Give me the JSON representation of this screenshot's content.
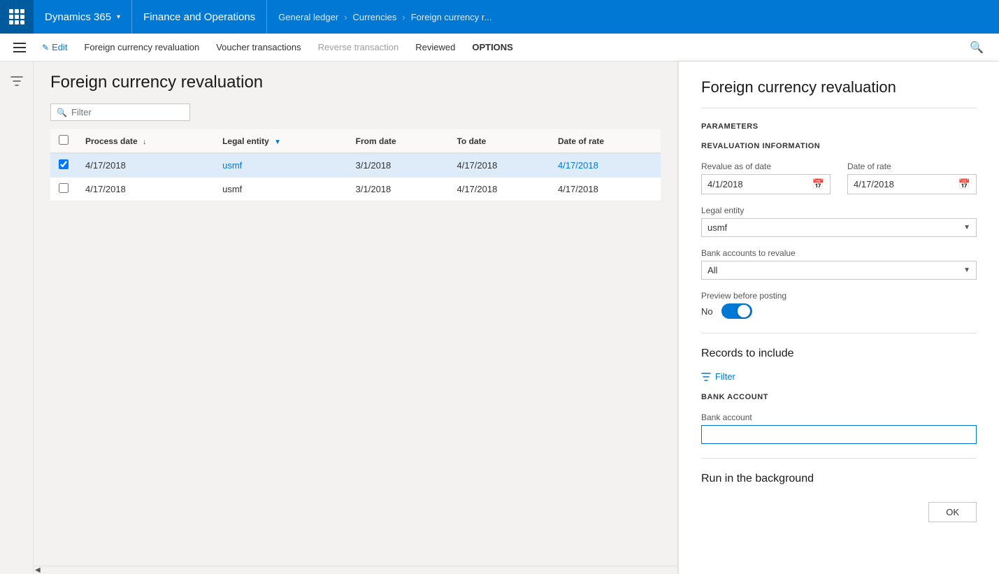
{
  "topNav": {
    "appsLabel": "Apps",
    "dynamics365": "Dynamics 365",
    "chevron": "▾",
    "financeOps": "Finance and Operations",
    "breadcrumbs": [
      {
        "label": "General ledger"
      },
      {
        "label": "Currencies"
      },
      {
        "label": "Foreign currency r..."
      }
    ]
  },
  "secondaryNav": {
    "editLabel": "Edit",
    "tabs": [
      {
        "label": "Foreign currency revaluation",
        "disabled": false
      },
      {
        "label": "Voucher transactions",
        "disabled": false
      },
      {
        "label": "Reverse transaction",
        "disabled": true
      },
      {
        "label": "Reviewed",
        "disabled": false
      },
      {
        "label": "OPTIONS",
        "disabled": false,
        "bold": true
      }
    ]
  },
  "pageTitle": "Foreign currency revaluation",
  "filter": {
    "placeholder": "Filter"
  },
  "table": {
    "columns": [
      {
        "label": "",
        "type": "checkbox"
      },
      {
        "label": "Process date",
        "sortable": true
      },
      {
        "label": "Legal entity",
        "filterable": true
      },
      {
        "label": "From date"
      },
      {
        "label": "To date"
      },
      {
        "label": "Date of rate"
      }
    ],
    "rows": [
      {
        "selected": true,
        "processDate": "4/17/2018",
        "legalEntity": "usmf",
        "legalEntityLink": true,
        "fromDate": "3/1/2018",
        "toDate": "4/17/2018",
        "dateOfRate": "4/17/2018"
      },
      {
        "selected": false,
        "processDate": "4/17/2018",
        "legalEntity": "usmf",
        "legalEntityLink": false,
        "fromDate": "3/1/2018",
        "toDate": "4/17/2018",
        "dateOfRate": "4/17/2018"
      }
    ]
  },
  "rightPanel": {
    "title": "Foreign currency revaluation",
    "parametersLabel": "Parameters",
    "revaluationInfoLabel": "REVALUATION INFORMATION",
    "revalueAsOfDate": {
      "label": "Revalue as of date",
      "value": "4/1/2018"
    },
    "dateOfRate": {
      "label": "Date of rate",
      "value": "4/17/2018"
    },
    "legalEntity": {
      "label": "Legal entity",
      "value": "usmf",
      "options": [
        "usmf"
      ]
    },
    "bankAccountsToRevalue": {
      "label": "Bank accounts to revalue",
      "value": "All",
      "options": [
        "All"
      ]
    },
    "previewBeforePosting": {
      "label": "Preview before posting",
      "toggleLabel": "No",
      "enabled": true
    },
    "recordsToInclude": {
      "label": "Records to include"
    },
    "filterBtn": "Filter",
    "bankAccount": {
      "sectionLabel": "BANK ACCOUNT",
      "fieldLabel": "Bank account",
      "value": ""
    },
    "runInBackground": "Run in the background",
    "okLabel": "OK"
  }
}
